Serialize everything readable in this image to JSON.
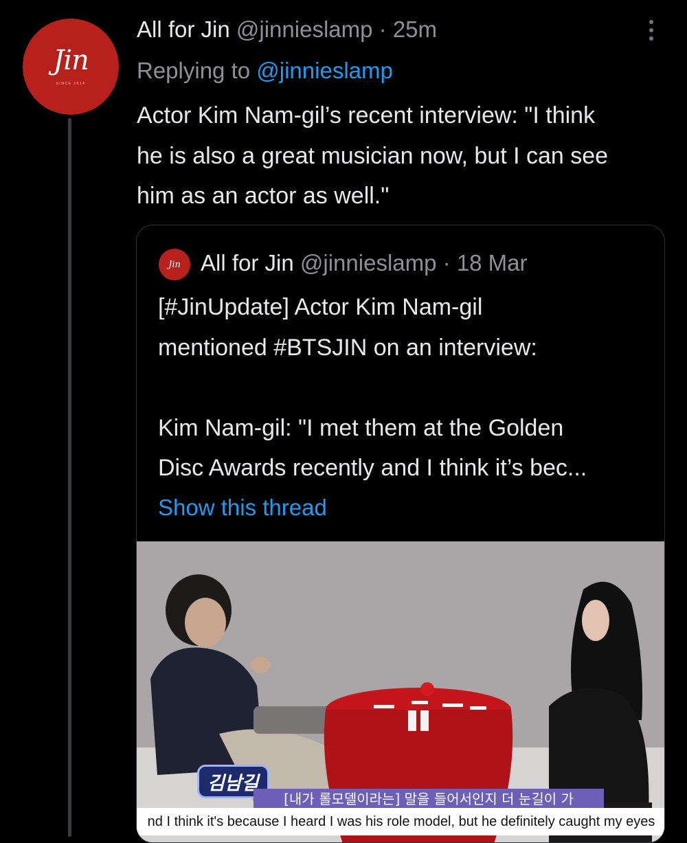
{
  "tweet": {
    "author_name": "All for Jin",
    "author_handle": "@jinnieslamp",
    "separator": " · ",
    "time": "25m",
    "replying_prefix": "Replying to ",
    "replying_handle": "@jinnieslamp",
    "text": "Actor Kim Nam-gil’s recent interview: \"I think\nhe is also a great musician now, but I can see\nhim as an actor as well.\"",
    "avatar_logo_text": "Jin",
    "avatar_logo_sub": "SINCE 2014",
    "more_icon": "more-vertical-icon"
  },
  "quoted_tweet": {
    "author_name": "All for Jin",
    "author_handle": "@jinnieslamp",
    "separator": " · ",
    "date": "18 Mar",
    "avatar_logo_text": "Jin",
    "text": "[#JinUpdate] Actor Kim Nam-gil\nmentioned #BTSJIN on an interview:\n\nKim Nam-gil: \"I met them at the Golden\nDisc Awards recently and I think it’s bec...",
    "show_thread_label": "Show this thread",
    "media": {
      "name_tag": "김남길",
      "subtitle_korean": "[내가 롤모델이라는] 말을 들어서인지 더 눈길이 가",
      "subtitle_english": "nd I think it's because I heard I was his role model, but he definitely caught my eyes"
    }
  },
  "colors": {
    "background": "#000000",
    "link": "#1d9bf0",
    "secondary_text": "#8b9196",
    "avatar_red": "#b8201c",
    "thread_line": "#3a3d40"
  }
}
